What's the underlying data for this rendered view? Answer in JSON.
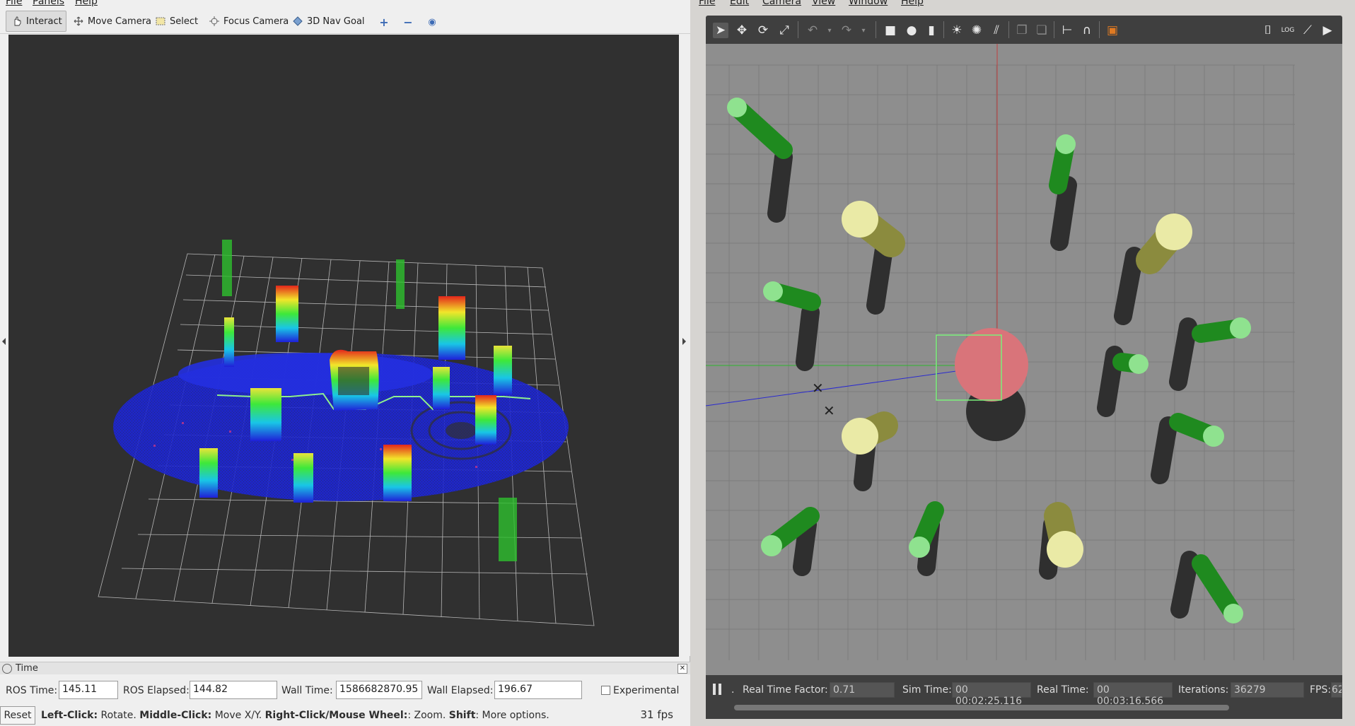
{
  "rviz": {
    "menu": [
      "File",
      "Panels",
      "Help"
    ],
    "toolbar": {
      "interact": "Interact",
      "move_camera": "Move Camera",
      "select": "Select",
      "focus_camera": "Focus Camera",
      "nav_goal": "3D Nav Goal"
    },
    "time_panel": {
      "title": "Time",
      "ros_time_label": "ROS Time:",
      "ros_time": "145.11",
      "ros_elapsed_label": "ROS Elapsed:",
      "ros_elapsed": "144.82",
      "wall_time_label": "Wall Time:",
      "wall_time": "1586682870.95",
      "wall_elapsed_label": "Wall Elapsed:",
      "wall_elapsed": "196.67",
      "experimental_label": "Experimental",
      "experimental_checked": false
    },
    "status": {
      "reset": "Reset",
      "hint_left_click": "Left-Click:",
      "hint_left_action": " Rotate. ",
      "hint_middle_click": "Middle-Click:",
      "hint_middle_action": " Move X/Y. ",
      "hint_right_click": "Right-Click/Mouse Wheel:",
      "hint_right_action": ": Zoom. ",
      "hint_shift": "Shift",
      "hint_shift_action": ": More options.",
      "fps": "31 fps"
    }
  },
  "gazebo": {
    "menu": [
      "File",
      "Edit",
      "Camera",
      "View",
      "Window",
      "Help"
    ],
    "status": {
      "pause_dot": ".",
      "real_time_factor_label": "Real Time Factor:",
      "real_time_factor": "0.71",
      "sim_time_label": "Sim Time:",
      "sim_time": "00 00:02:25.116",
      "real_time_label": "Real Time:",
      "real_time": "00 00:03:16.566",
      "iterations_label": "Iterations:",
      "iterations": "36279",
      "fps_label": "FPS:",
      "fps": "62"
    },
    "colors": {
      "ground": "#8e8e8e",
      "grid": "#7a7a7a",
      "green_cylinder": "#1e8c1e",
      "green_cap": "#8ee38e",
      "yellow_cylinder": "#8a8a3c",
      "yellow_cap": "#eaeaa8",
      "robot_sphere": "#d9747a",
      "shadow": "#2f2f2f"
    }
  }
}
